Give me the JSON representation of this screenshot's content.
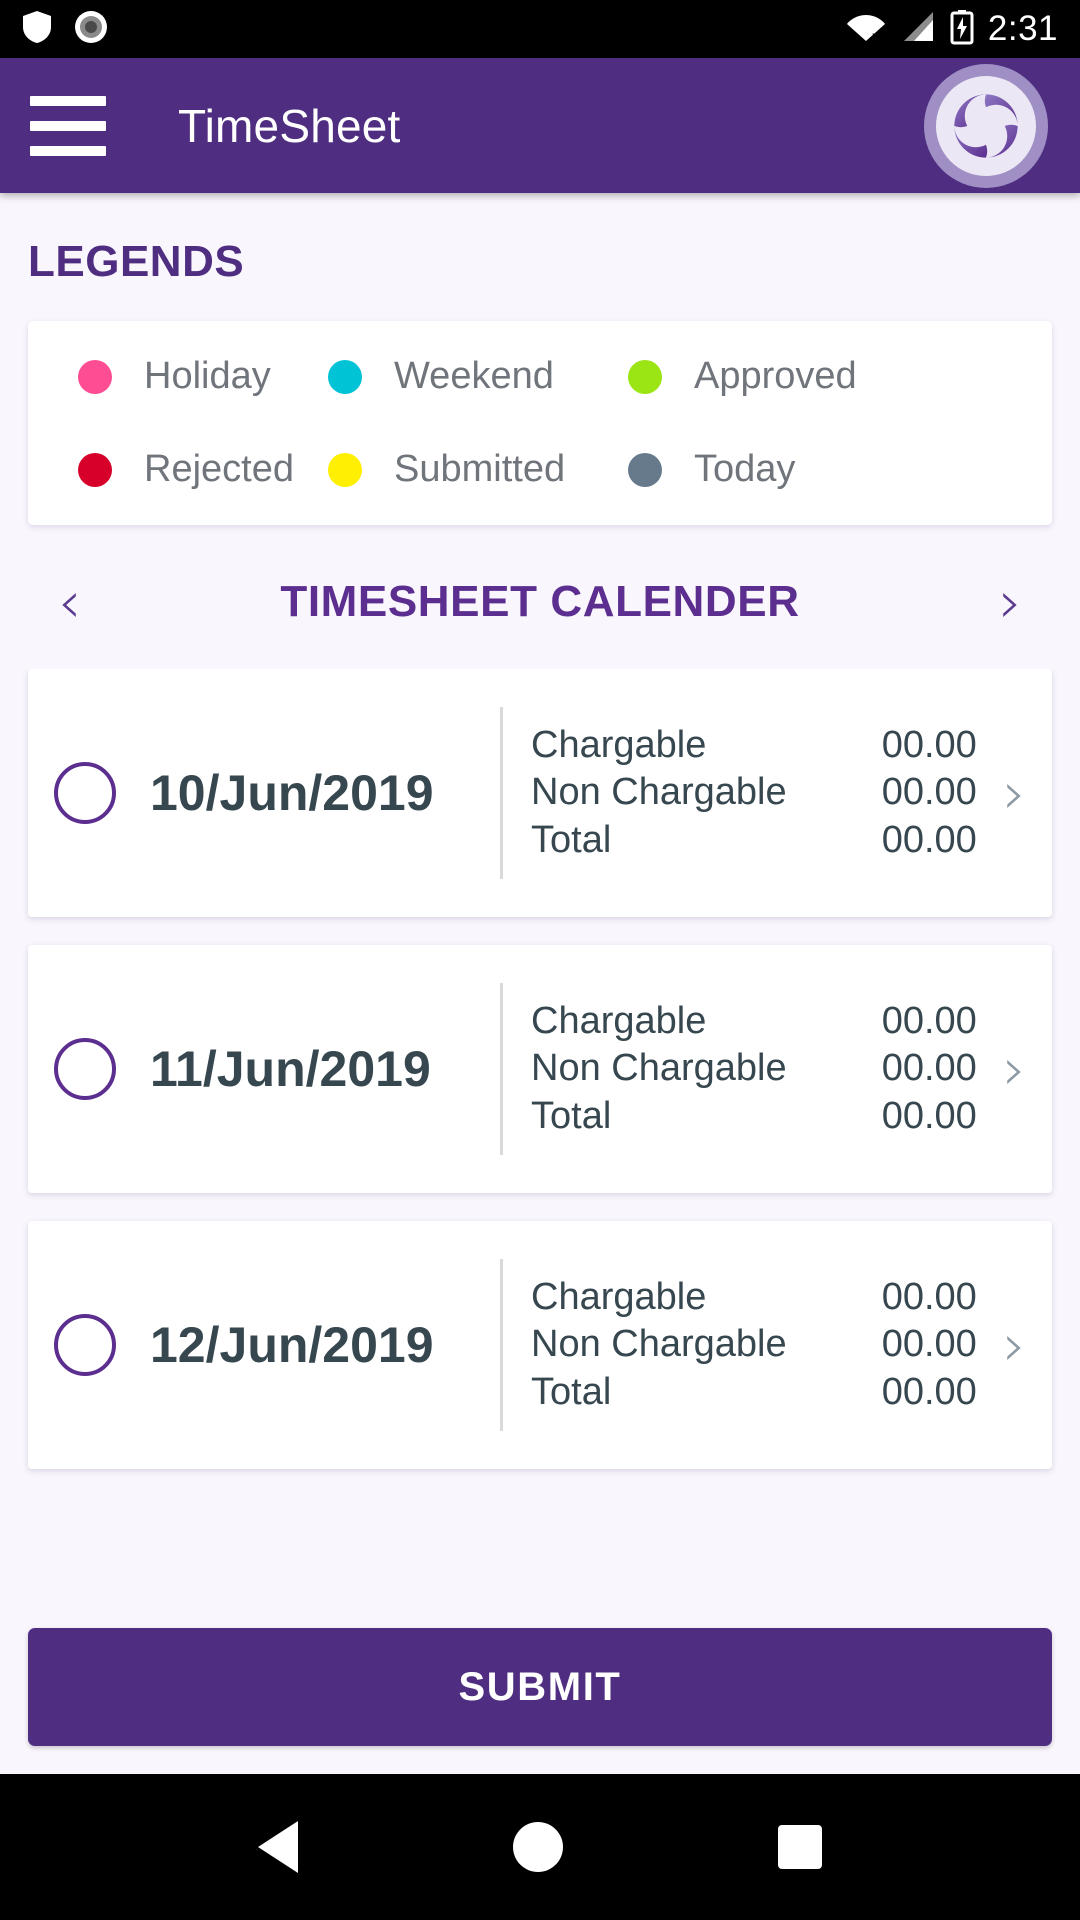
{
  "statusbar": {
    "icons": [
      "shield-icon",
      "screen-record-icon",
      "wifi-off-icon",
      "signal-icon",
      "battery-charging-icon"
    ],
    "time": "2:31"
  },
  "appbar": {
    "menu_icon": "hamburger-menu-icon",
    "title": "TimeSheet",
    "logo_icon": "app-logo-swirl-icon"
  },
  "legends": {
    "title": "LEGENDS",
    "items": [
      {
        "label": "Holiday",
        "color": "#ff4d94"
      },
      {
        "label": "Weekend",
        "color": "#00c4d6"
      },
      {
        "label": "Approved",
        "color": "#9be514"
      },
      {
        "label": "Rejected",
        "color": "#d6002b"
      },
      {
        "label": "Submitted",
        "color": "#ffef00"
      },
      {
        "label": "Today",
        "color": "#667a8c"
      }
    ]
  },
  "calendar": {
    "prev_label": "‹",
    "next_label": "›",
    "title": "TIMESHEET CALENDER",
    "row_chevron": "›",
    "rows": [
      {
        "date": "10/Jun/2019",
        "selected": false,
        "chargable_label": "Chargable",
        "chargable_value": "00.00",
        "non_chargable_label": "Non Chargable",
        "non_chargable_value": "00.00",
        "total_label": "Total",
        "total_value": "00.00"
      },
      {
        "date": "11/Jun/2019",
        "selected": false,
        "chargable_label": "Chargable",
        "chargable_value": "00.00",
        "non_chargable_label": "Non Chargable",
        "non_chargable_value": "00.00",
        "total_label": "Total",
        "total_value": "00.00"
      },
      {
        "date": "12/Jun/2019",
        "selected": false,
        "chargable_label": "Chargable",
        "chargable_value": "00.00",
        "non_chargable_label": "Non Chargable",
        "non_chargable_value": "00.00",
        "total_label": "Total",
        "total_value": "00.00"
      }
    ]
  },
  "submit": {
    "label": "SUBMIT"
  },
  "navbar": {
    "back_icon": "back-triangle-icon",
    "home_icon": "home-circle-icon",
    "recents_icon": "recents-square-icon"
  },
  "colors": {
    "brand_purple": "#4f2d80",
    "title_purple": "#5b2e8f",
    "page_bg": "#f9f6fd",
    "card_bg": "#ffffff",
    "text_dark": "#37474f",
    "text_gray": "#70757c"
  }
}
